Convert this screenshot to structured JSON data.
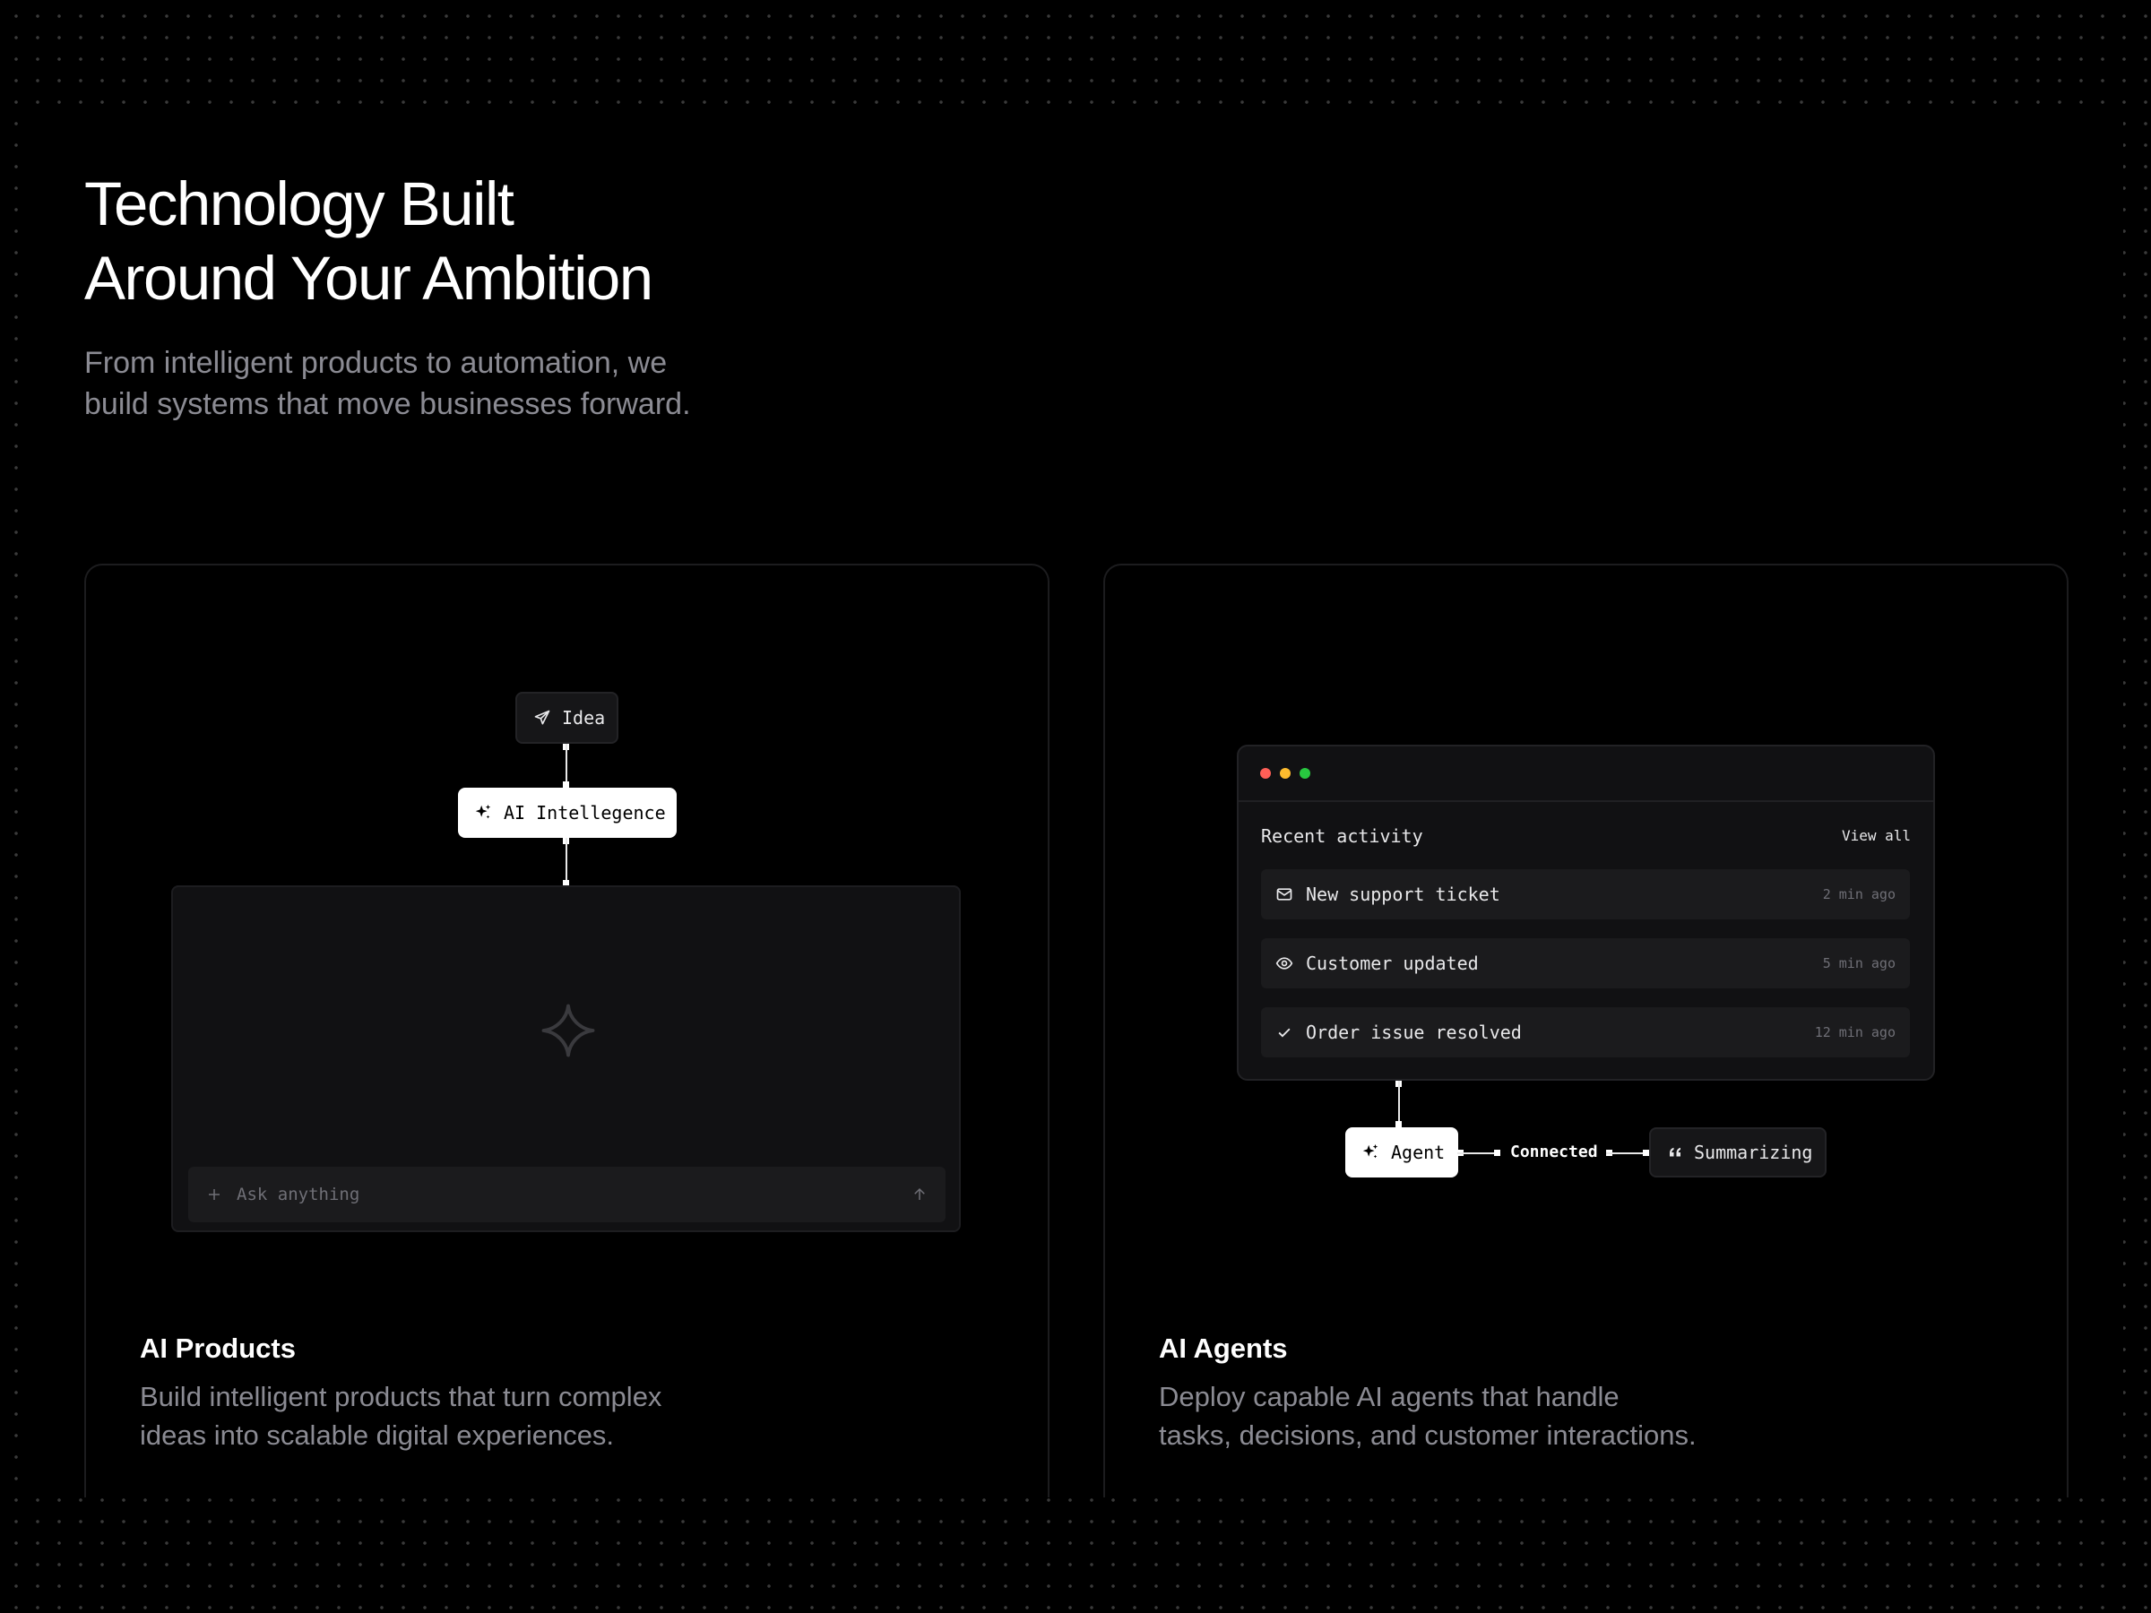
{
  "hero": {
    "title": "Technology Built\nAround Your Ambition",
    "subtitle": "From intelligent products to automation, we\nbuild systems that move businesses forward."
  },
  "cards": [
    {
      "title": "AI Products",
      "description": "Build intelligent products that turn complex\nideas into scalable digital experiences.",
      "illustration": {
        "idea_label": "Idea",
        "ai_label": "AI Intellegence",
        "input_placeholder": "Ask anything",
        "icons": [
          "send-icon",
          "sparkles-icon",
          "sparkle-icon",
          "plus-icon",
          "arrow-up-icon"
        ]
      }
    },
    {
      "title": "AI Agents",
      "description": "Deploy capable AI agents that handle\ntasks, decisions, and customer interactions.",
      "illustration": {
        "window_title": "Recent activity",
        "view_all_label": "View all",
        "window_dots": [
          "#ff5f57",
          "#febc2e",
          "#28c840"
        ],
        "activity": [
          {
            "icon": "mail-icon",
            "label": "New support ticket",
            "time": "2 min ago"
          },
          {
            "icon": "eye-icon",
            "label": "Customer updated",
            "time": "5 min ago"
          },
          {
            "icon": "check-icon",
            "label": "Order issue resolved",
            "time": "12 min ago"
          }
        ],
        "agent_label": "Agent",
        "connection_label": "Connected",
        "status_label": "Summarizing"
      }
    }
  ]
}
